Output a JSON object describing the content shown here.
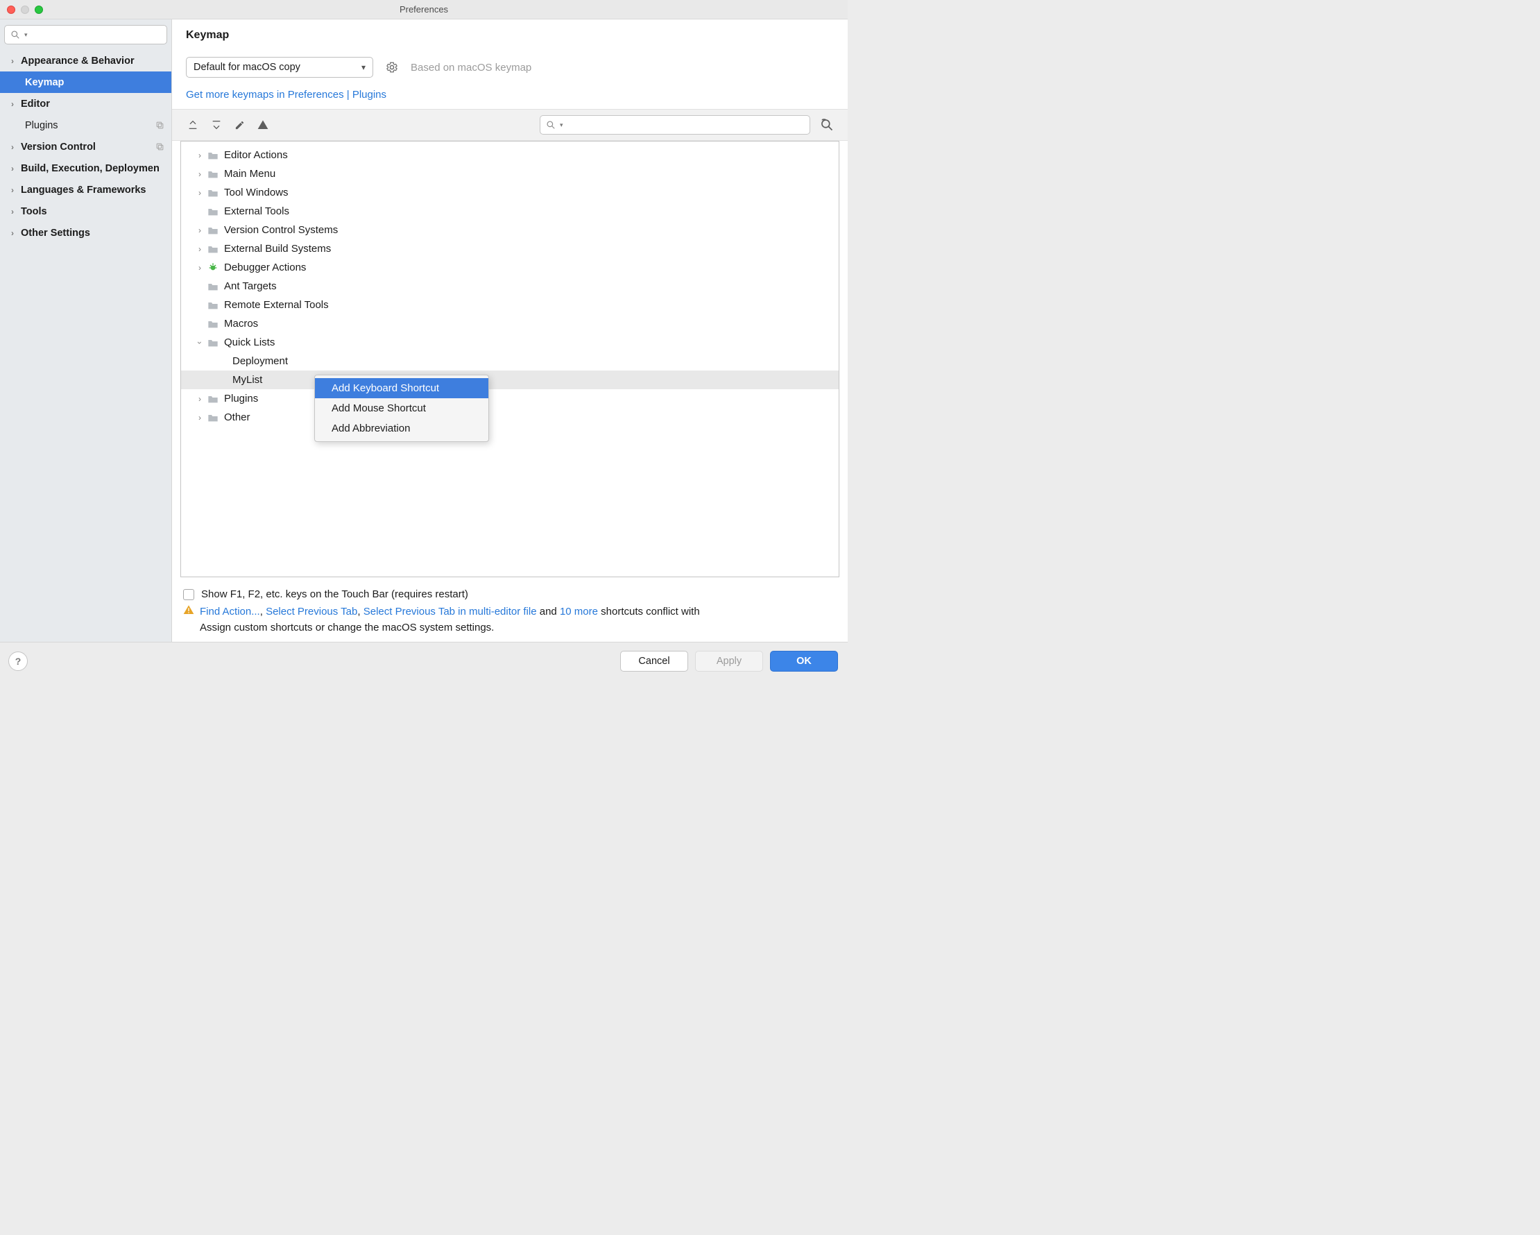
{
  "window": {
    "title": "Preferences"
  },
  "sidebar": {
    "search_placeholder": "",
    "items": [
      {
        "label": "Appearance & Behavior",
        "hasChildren": true
      },
      {
        "label": "Keymap",
        "child": true,
        "selected": true
      },
      {
        "label": "Editor",
        "hasChildren": true
      },
      {
        "label": "Plugins",
        "child": true,
        "plain": true,
        "trailIcon": "copy"
      },
      {
        "label": "Version Control",
        "hasChildren": true,
        "trailIcon": "copy"
      },
      {
        "label": "Build, Execution, Deployment",
        "hasChildren": true
      },
      {
        "label": "Languages & Frameworks",
        "hasChildren": true
      },
      {
        "label": "Tools",
        "hasChildren": true
      },
      {
        "label": "Other Settings",
        "hasChildren": true
      }
    ]
  },
  "page": {
    "heading": "Keymap",
    "profile": "Default for macOS copy",
    "based_on": "Based on macOS keymap",
    "plugins_link": "Get more keymaps in Preferences | Plugins",
    "touchbar_label": "Show F1, F2, etc. keys on the Touch Bar (requires restart)",
    "conflict": {
      "find_action": "Find Action...",
      "sep1": ", ",
      "select_prev": "Select Previous Tab",
      "sep2": ", ",
      "select_prev_multi": "Select Previous Tab in multi-editor file",
      "and": " and ",
      "more": "10 more",
      "tail": " shortcuts conflict with",
      "line2": "Assign custom shortcuts or change the macOS system settings."
    }
  },
  "tree": [
    {
      "label": "Editor Actions",
      "icon": "folder-edit",
      "chev": true
    },
    {
      "label": "Main Menu",
      "icon": "folder-menu",
      "chev": true
    },
    {
      "label": "Tool Windows",
      "icon": "folder",
      "chev": true
    },
    {
      "label": "External Tools",
      "icon": "folder-menu"
    },
    {
      "label": "Version Control Systems",
      "icon": "folder",
      "chev": true
    },
    {
      "label": "External Build Systems",
      "icon": "folder-gear",
      "chev": true
    },
    {
      "label": "Debugger Actions",
      "icon": "bug",
      "chev": true
    },
    {
      "label": "Ant Targets",
      "icon": "folder-ant"
    },
    {
      "label": "Remote External Tools",
      "icon": "folder-menu"
    },
    {
      "label": "Macros",
      "icon": "folder"
    },
    {
      "label": "Quick Lists",
      "icon": "folder",
      "chev": true,
      "open": true
    },
    {
      "label": "Deployment",
      "leaf": true
    },
    {
      "label": "MyList",
      "leaf": true,
      "selected": true
    },
    {
      "label": "Plugins",
      "icon": "folder",
      "chev": true
    },
    {
      "label": "Other",
      "icon": "folder-multi",
      "chev": true
    }
  ],
  "context_menu": {
    "items": [
      {
        "label": "Add Keyboard Shortcut",
        "hl": true
      },
      {
        "label": "Add Mouse Shortcut"
      },
      {
        "label": "Add Abbreviation"
      }
    ]
  },
  "footer": {
    "cancel": "Cancel",
    "apply": "Apply",
    "ok": "OK"
  }
}
